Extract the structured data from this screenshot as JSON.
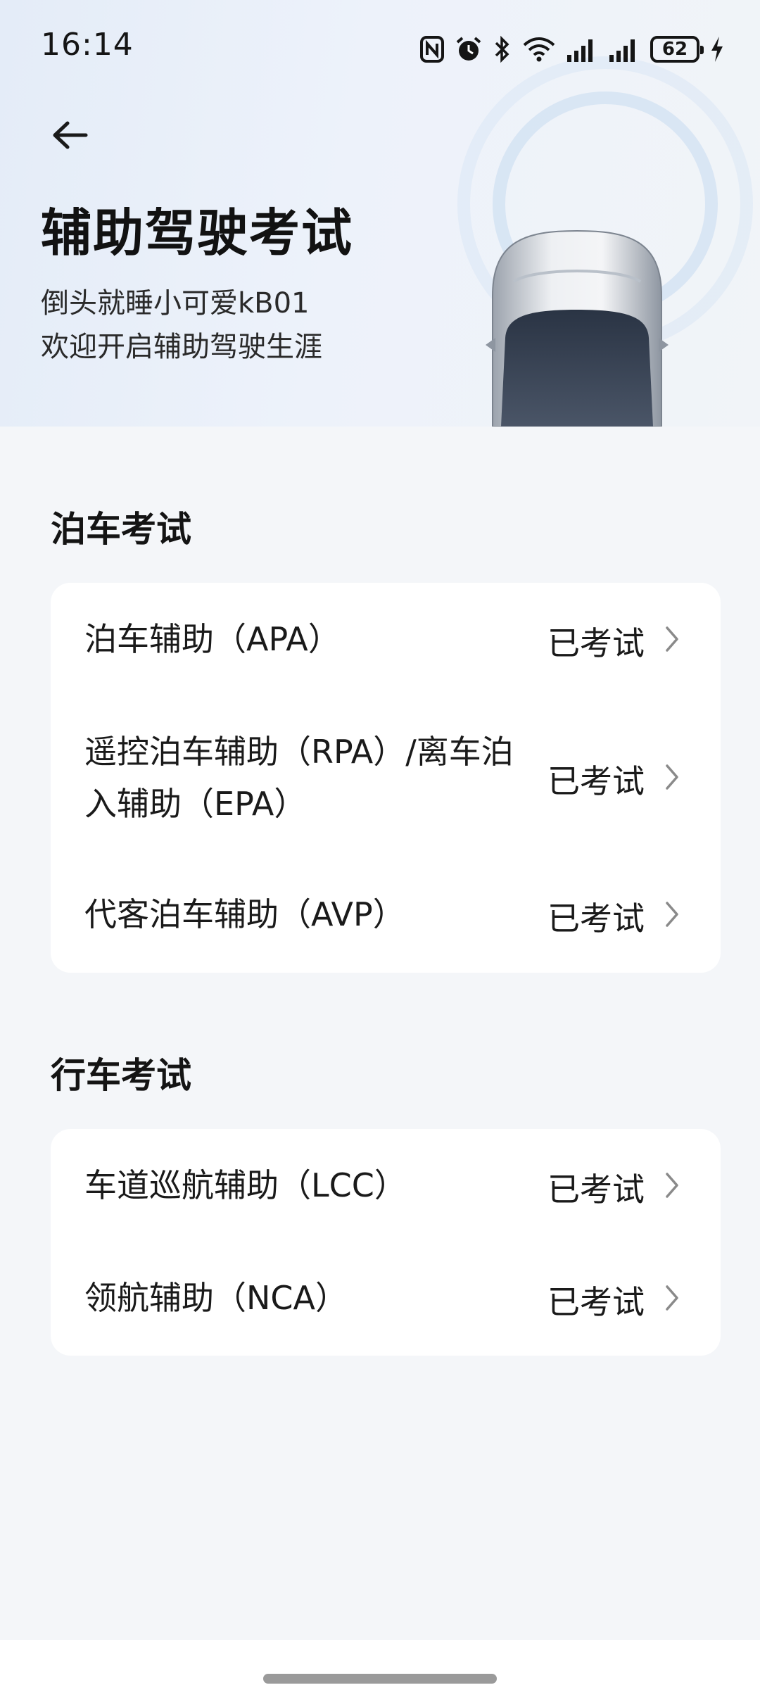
{
  "status_bar": {
    "time": "16:14",
    "battery": "62",
    "icons": [
      "nfc-icon",
      "alarm-icon",
      "bluetooth-icon",
      "wifi-icon",
      "signal-icon",
      "signal-icon",
      "battery-icon",
      "charging-icon"
    ]
  },
  "header": {
    "back_icon": "back-arrow-icon",
    "title": "辅助驾驶考试",
    "username": "倒头就睡小可爱kB01",
    "welcome": "欢迎开启辅助驾驶生涯"
  },
  "sections": [
    {
      "title": "泊车考试",
      "items": [
        {
          "label": "泊车辅助（APA）",
          "status": "已考试"
        },
        {
          "label": "遥控泊车辅助（RPA）/离车泊入辅助（EPA）",
          "status": "已考试"
        },
        {
          "label": "代客泊车辅助（AVP）",
          "status": "已考试"
        }
      ]
    },
    {
      "title": "行车考试",
      "items": [
        {
          "label": "车道巡航辅助（LCC）",
          "status": "已考试"
        },
        {
          "label": "领航辅助（NCA）",
          "status": "已考试"
        }
      ]
    }
  ],
  "colors": {
    "banner_start": "#e4ecf8",
    "page_bg": "#f4f6f9",
    "card_bg": "#ffffff",
    "text": "#1a1a1a",
    "chevron": "#8a8a8a"
  }
}
